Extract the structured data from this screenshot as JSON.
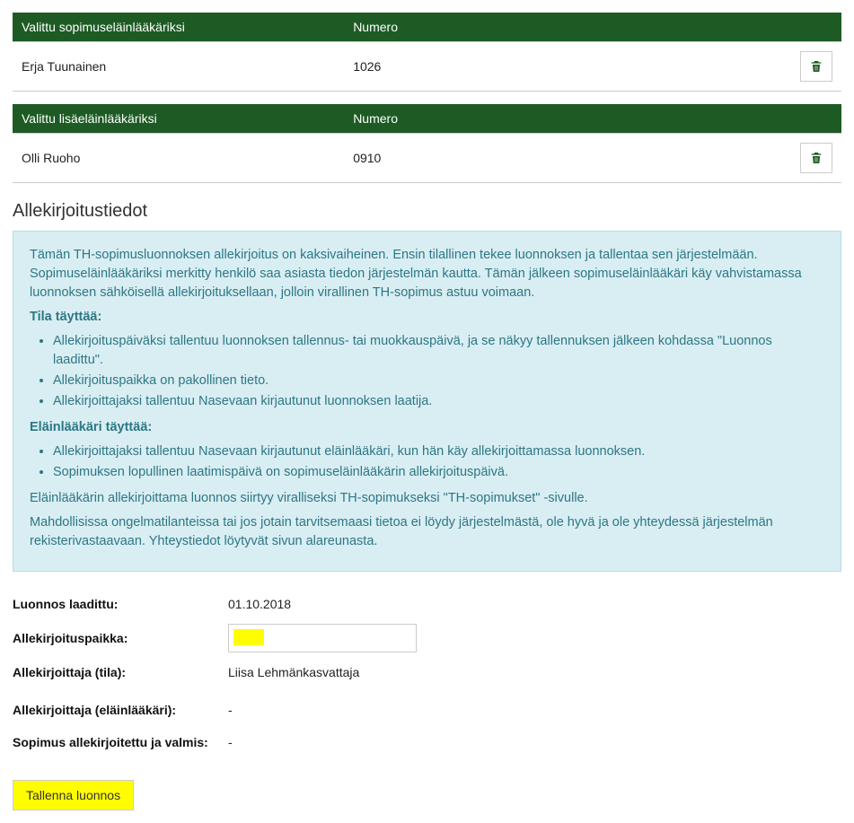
{
  "table1": {
    "headers": {
      "name": "Valittu sopimuseläinlääkäriksi",
      "number": "Numero"
    },
    "rows": [
      {
        "name": "Erja Tuunainen",
        "number": "1026"
      }
    ]
  },
  "table2": {
    "headers": {
      "name": "Valittu lisäeläinlääkäriksi",
      "number": "Numero"
    },
    "rows": [
      {
        "name": "Olli Ruoho",
        "number": "0910"
      }
    ]
  },
  "section_title": "Allekirjoitustiedot",
  "info": {
    "p1": "Tämän TH-sopimusluonnoksen allekirjoitus on kaksivaiheinen. Ensin tilallinen tekee luonnoksen ja tallentaa sen järjestelmään. Sopimuseläinlääkäriksi merkitty henkilö saa asiasta tiedon järjestelmän kautta. Tämän jälkeen sopimuseläinlääkäri käy vahvistamassa luonnoksen sähköisellä allekirjoituksellaan, jolloin virallinen TH-sopimus astuu voimaan.",
    "tila_title": "Tila täyttää:",
    "tila_items": [
      "Allekirjoituspäiväksi tallentuu luonnoksen tallennus- tai muokkauspäivä, ja se näkyy tallennuksen jälkeen kohdassa \"Luonnos laadittu\".",
      "Allekirjoituspaikka on pakollinen tieto.",
      "Allekirjoittajaksi tallentuu Nasevaan kirjautunut luonnoksen laatija."
    ],
    "el_title": "Eläinlääkäri täyttää:",
    "el_items": [
      "Allekirjoittajaksi tallentuu Nasevaan kirjautunut eläinlääkäri, kun hän käy allekirjoittamassa luonnoksen.",
      "Sopimuksen lopullinen laatimispäivä on sopimuseläinlääkärin allekirjoituspäivä."
    ],
    "p2": "Eläinlääkärin allekirjoittama luonnos siirtyy viralliseksi TH-sopimukseksi \"TH-sopimukset\" -sivulle.",
    "p3": "Mahdollisissa ongelmatilanteissa tai jos jotain tarvitsemaasi tietoa ei löydy järjestelmästä, ole hyvä ja ole yhteydessä järjestelmän rekisterivastaavaan. Yhteystiedot löytyvät sivun alareunasta."
  },
  "form": {
    "draft_date_label": "Luonnos laadittu:",
    "draft_date": "01.10.2018",
    "place_label": "Allekirjoituspaikka:",
    "signer_farm_label": "Allekirjoittaja (tila):",
    "signer_farm": "Liisa Lehmänkasvattaja",
    "signer_vet_label": "Allekirjoittaja (eläinlääkäri):",
    "signer_vet": "-",
    "signed_ready_label": "Sopimus allekirjoitettu ja valmis:",
    "signed_ready": "-"
  },
  "buttons": {
    "save_draft": "Tallenna luonnos"
  }
}
